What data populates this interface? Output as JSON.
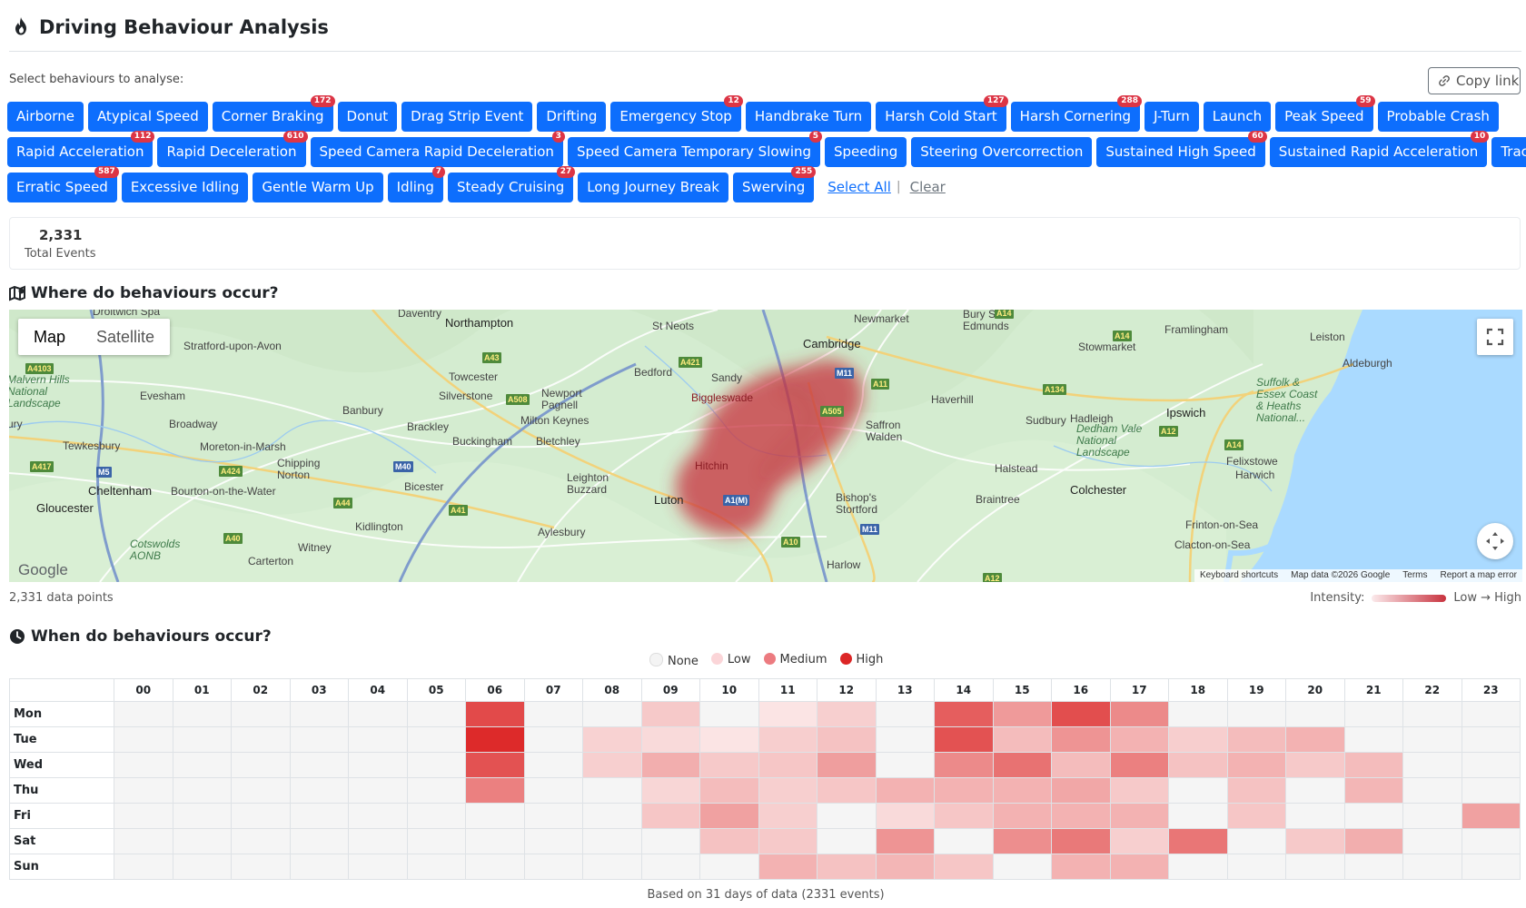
{
  "header": {
    "title": "Driving Behaviour Analysis",
    "icon": "flame-icon"
  },
  "selector": {
    "label": "Select behaviours to analyse:",
    "copy_link": "Copy link",
    "select_all": "Select All",
    "clear": "Clear",
    "rows": [
      [
        {
          "label": "Airborne",
          "badge": ""
        },
        {
          "label": "Atypical Speed",
          "badge": ""
        },
        {
          "label": "Corner Braking",
          "badge": "172"
        },
        {
          "label": "Donut",
          "badge": ""
        },
        {
          "label": "Drag Strip Event",
          "badge": ""
        },
        {
          "label": "Drifting",
          "badge": ""
        },
        {
          "label": "Emergency Stop",
          "badge": "12"
        },
        {
          "label": "Handbrake Turn",
          "badge": ""
        },
        {
          "label": "Harsh Cold Start",
          "badge": "127"
        },
        {
          "label": "Harsh Cornering",
          "badge": "288"
        },
        {
          "label": "J-Turn",
          "badge": ""
        },
        {
          "label": "Launch",
          "badge": ""
        },
        {
          "label": "Peak Speed",
          "badge": "59"
        },
        {
          "label": "Probable Crash",
          "badge": ""
        }
      ],
      [
        {
          "label": "Rapid Acceleration",
          "badge": "112"
        },
        {
          "label": "Rapid Deceleration",
          "badge": "610"
        },
        {
          "label": "Speed Camera Rapid Deceleration",
          "badge": "3"
        },
        {
          "label": "Speed Camera Temporary Slowing",
          "badge": "5"
        },
        {
          "label": "Speeding",
          "badge": ""
        },
        {
          "label": "Steering Overcorrection",
          "badge": ""
        },
        {
          "label": "Sustained High Speed",
          "badge": "60"
        },
        {
          "label": "Sustained Rapid Acceleration",
          "badge": "10"
        },
        {
          "label": "Track Day",
          "badge": ""
        }
      ],
      [
        {
          "label": "Erratic Speed",
          "badge": "587"
        },
        {
          "label": "Excessive Idling",
          "badge": ""
        },
        {
          "label": "Gentle Warm Up",
          "badge": ""
        },
        {
          "label": "Idling",
          "badge": "7"
        },
        {
          "label": "Steady Cruising",
          "badge": "27"
        },
        {
          "label": "Long Journey Break",
          "badge": ""
        },
        {
          "label": "Swerving",
          "badge": "255"
        }
      ]
    ]
  },
  "stats": {
    "total": "2,331",
    "total_label": "Total Events"
  },
  "map_section": {
    "title": "Where do behaviours occur?",
    "map_label": "Map",
    "satellite_label": "Satellite",
    "google": "Google",
    "attrib": [
      "Keyboard shortcuts",
      "Map data ©2026 Google",
      "Terms",
      "Report a map error"
    ],
    "data_points": "2,331 data points",
    "intensity_label": "Intensity:",
    "intensity_range": "Low → High",
    "places": [
      {
        "name": "Droitwich Spa",
        "cls": ""
      },
      {
        "name": "Daventry",
        "cls": ""
      },
      {
        "name": "Northampton",
        "cls": "big"
      },
      {
        "name": "St Neots",
        "cls": ""
      },
      {
        "name": "Newmarket",
        "cls": ""
      },
      {
        "name": "Bury St\nEdmunds",
        "cls": ""
      },
      {
        "name": "Framlingham",
        "cls": ""
      },
      {
        "name": "Leiston",
        "cls": ""
      },
      {
        "name": "Stratford-upon-Avon",
        "cls": ""
      },
      {
        "name": "Cambridge",
        "cls": "big"
      },
      {
        "name": "Stowmarket",
        "cls": ""
      },
      {
        "name": "Aldeburgh",
        "cls": ""
      },
      {
        "name": "Bedford",
        "cls": ""
      },
      {
        "name": "Sandy",
        "cls": ""
      },
      {
        "name": "Towcester",
        "cls": ""
      },
      {
        "name": "Malvern Hills\nNational\nLandscape",
        "cls": "park"
      },
      {
        "name": "Evesham",
        "cls": ""
      },
      {
        "name": "Silverstone",
        "cls": ""
      },
      {
        "name": "Newport\nPagnell",
        "cls": ""
      },
      {
        "name": "Biggleswade",
        "cls": ""
      },
      {
        "name": "Haverhill",
        "cls": ""
      },
      {
        "name": "Suffolk &\nEssex Coast\n& Heaths\nNational...",
        "cls": "park"
      },
      {
        "name": "Banbury",
        "cls": ""
      },
      {
        "name": "Milton Keynes",
        "cls": ""
      },
      {
        "name": "Saffron\nWalden",
        "cls": ""
      },
      {
        "name": "Hadleigh",
        "cls": ""
      },
      {
        "name": "Ipswich",
        "cls": "big"
      },
      {
        "name": "Broadway",
        "cls": ""
      },
      {
        "name": "Brackley",
        "cls": ""
      },
      {
        "name": "Sudbury",
        "cls": ""
      },
      {
        "name": "Dedham Vale\nNational\nLandscape",
        "cls": "park"
      },
      {
        "name": "Bletchley",
        "cls": ""
      },
      {
        "name": "Buckingham",
        "cls": ""
      },
      {
        "name": "Tewkesbury",
        "cls": ""
      },
      {
        "name": "Moreton-in-Marsh",
        "cls": ""
      },
      {
        "name": "Hitchin",
        "cls": ""
      },
      {
        "name": "Felixstowe",
        "cls": ""
      },
      {
        "name": "Chipping\nNorton",
        "cls": ""
      },
      {
        "name": "Halstead",
        "cls": ""
      },
      {
        "name": "Harwich",
        "cls": ""
      },
      {
        "name": "Leighton\nBuzzard",
        "cls": ""
      },
      {
        "name": "Cheltenham",
        "cls": "big"
      },
      {
        "name": "Bourton-on-the-Water",
        "cls": ""
      },
      {
        "name": "Bicester",
        "cls": ""
      },
      {
        "name": "Colchester",
        "cls": "big"
      },
      {
        "name": "Luton",
        "cls": "big"
      },
      {
        "name": "Bishop's\nStortford",
        "cls": ""
      },
      {
        "name": "Braintree",
        "cls": ""
      },
      {
        "name": "Gloucester",
        "cls": "big"
      },
      {
        "name": "Kidlington",
        "cls": ""
      },
      {
        "name": "Aylesbury",
        "cls": ""
      },
      {
        "name": "Frinton-on-Sea",
        "cls": ""
      },
      {
        "name": "Clacton-on-Sea",
        "cls": ""
      },
      {
        "name": "Cotswolds\nAONB",
        "cls": "park"
      },
      {
        "name": "Witney",
        "cls": ""
      },
      {
        "name": "Harlow",
        "cls": ""
      },
      {
        "name": "Carterton",
        "cls": ""
      },
      {
        "name": "ury",
        "cls": ""
      }
    ],
    "roads": [
      {
        "name": "A14",
        "m": false
      },
      {
        "name": "A14",
        "m": false
      },
      {
        "name": "A4103",
        "m": false
      },
      {
        "name": "A43",
        "m": false
      },
      {
        "name": "A421",
        "m": false
      },
      {
        "name": "M11",
        "m": true
      },
      {
        "name": "A11",
        "m": false
      },
      {
        "name": "A508",
        "m": false
      },
      {
        "name": "A134",
        "m": false
      },
      {
        "name": "A505",
        "m": false
      },
      {
        "name": "A12",
        "m": false
      },
      {
        "name": "A14",
        "m": false
      },
      {
        "name": "M5",
        "m": true
      },
      {
        "name": "A417",
        "m": false
      },
      {
        "name": "M40",
        "m": true
      },
      {
        "name": "A424",
        "m": false
      },
      {
        "name": "A44",
        "m": false
      },
      {
        "name": "A41",
        "m": false
      },
      {
        "name": "A1(M)",
        "m": true
      },
      {
        "name": "M11",
        "m": true
      },
      {
        "name": "A40",
        "m": false
      },
      {
        "name": "A10",
        "m": false
      },
      {
        "name": "A12",
        "m": false
      }
    ]
  },
  "time_section": {
    "title": "When do behaviours occur?",
    "legend": [
      {
        "label": "None",
        "color": "#f4f4f4"
      },
      {
        "label": "Low",
        "color": "#fbd5d8"
      },
      {
        "label": "Medium",
        "color": "#ec7b80"
      },
      {
        "label": "High",
        "color": "#dc2626"
      }
    ],
    "hours": [
      "00",
      "01",
      "02",
      "03",
      "04",
      "05",
      "06",
      "07",
      "08",
      "09",
      "10",
      "11",
      "12",
      "13",
      "14",
      "15",
      "16",
      "17",
      "18",
      "19",
      "20",
      "21",
      "22",
      "23"
    ],
    "days": [
      "Mon",
      "Tue",
      "Wed",
      "Thu",
      "Fri",
      "Sat",
      "Sun"
    ],
    "intensity": [
      [
        0,
        0,
        0,
        0,
        0,
        0,
        0.82,
        0,
        0,
        0.18,
        0,
        0.05,
        0.15,
        0,
        0.72,
        0.42,
        0.8,
        0.5,
        0,
        0,
        0,
        0,
        0,
        0
      ],
      [
        0,
        0,
        0,
        0,
        0,
        0,
        0.98,
        0,
        0.14,
        0.1,
        0.05,
        0.16,
        0.22,
        0,
        0.78,
        0.25,
        0.45,
        0.3,
        0.16,
        0.25,
        0.3,
        0,
        0,
        0
      ],
      [
        0,
        0,
        0,
        0,
        0,
        0,
        0.78,
        0,
        0.15,
        0.32,
        0.18,
        0.2,
        0.4,
        0,
        0.5,
        0.62,
        0.25,
        0.55,
        0.22,
        0.3,
        0.18,
        0.25,
        0,
        0
      ],
      [
        0,
        0,
        0,
        0,
        0,
        0,
        0.55,
        0,
        0,
        0.12,
        0.25,
        0.15,
        0.2,
        0.3,
        0.3,
        0.3,
        0.35,
        0.18,
        0,
        0.22,
        0,
        0.28,
        0,
        0
      ],
      [
        0,
        0,
        0,
        0,
        0,
        0,
        0,
        0,
        0,
        0.2,
        0.38,
        0.15,
        0,
        0.1,
        0.2,
        0.3,
        0.3,
        0.3,
        0,
        0.2,
        0,
        0,
        0,
        0.38
      ],
      [
        0,
        0,
        0,
        0,
        0,
        0,
        0,
        0,
        0,
        0,
        0.22,
        0.18,
        0,
        0.45,
        0,
        0.48,
        0.58,
        0.15,
        0.6,
        0,
        0.18,
        0.32,
        0,
        0
      ],
      [
        0,
        0,
        0,
        0,
        0,
        0,
        0,
        0,
        0,
        0,
        0,
        0.3,
        0.22,
        0.28,
        0.2,
        0,
        0.3,
        0.3,
        0,
        0,
        0,
        0,
        0,
        0
      ]
    ],
    "footer": "Based on 31 days of data (2331 events)"
  }
}
